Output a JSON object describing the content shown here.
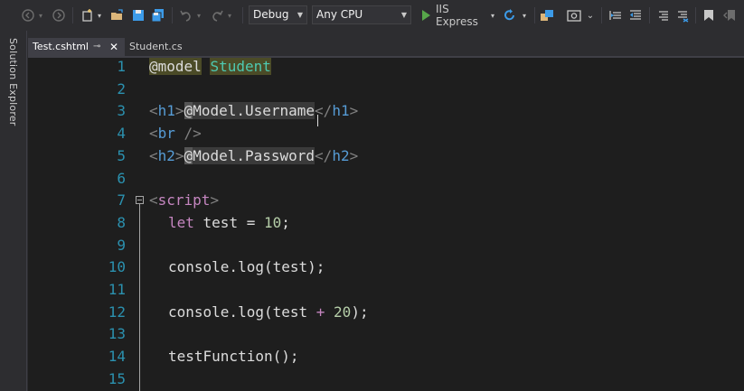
{
  "toolbar": {
    "configuration": "Debug",
    "platform": "Any CPU",
    "run_target": "IIS Express",
    "icons": [
      "back-icon",
      "forward-icon",
      "new-project-icon",
      "open-file-icon",
      "save-icon",
      "save-all-icon",
      "undo-icon",
      "redo-icon",
      "play-icon",
      "refresh-icon",
      "browser-link-icon",
      "screenshot-icon",
      "indent-icon",
      "outdent-icon",
      "comment-icon",
      "uncomment-icon",
      "bookmark-icon",
      "prev-bookmark-icon"
    ]
  },
  "sidebar": {
    "label": "Solution Explorer"
  },
  "tabs": [
    {
      "label": "Test.cshtml",
      "active": true
    },
    {
      "label": "Student.cs",
      "active": false
    }
  ],
  "editor": {
    "line_numbers": [
      "1",
      "2",
      "3",
      "4",
      "5",
      "6",
      "7",
      "8",
      "9",
      "10",
      "11",
      "12",
      "13",
      "14",
      "15"
    ],
    "lines": {
      "l1_directive": "@model",
      "l1_class": "Student",
      "l3_open": "<",
      "l3_tag": "h1",
      "l3_close": ">",
      "l3_at": "@",
      "l3_model": "Model.Username",
      "l3_end_open": "</",
      "l3_end_tag": "h1",
      "l3_end_close": ">",
      "l4_open": "<",
      "l4_tag": "br",
      "l4_close": " />",
      "l5_open": "<",
      "l5_tag": "h2",
      "l5_close": ">",
      "l5_at": "@",
      "l5_model": "Model.Password",
      "l5_end_open": "</",
      "l5_end_tag": "h2",
      "l5_end_close": ">",
      "l7_open": "<",
      "l7_tag": "script",
      "l7_close": ">",
      "l8_kw": "let",
      "l8_rest": " test = ",
      "l8_num": "10",
      "l8_end": ";",
      "l10": "console.log(test);",
      "l12_a": "console.log(test ",
      "l12_op": "+",
      "l12_b": " ",
      "l12_num": "20",
      "l12_end": ");",
      "l14": "testFunction();"
    }
  }
}
